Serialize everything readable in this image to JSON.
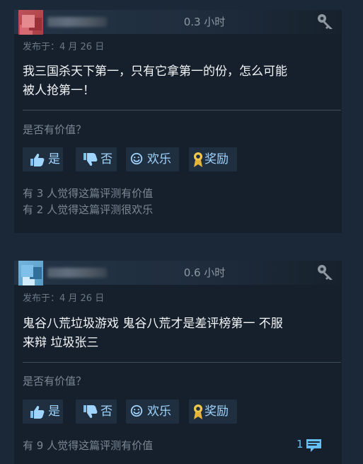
{
  "reviews": [
    {
      "hours": "0.3 小时",
      "posted": "发布于：4 月 26 日",
      "content_lines": [
        "我三国杀天下第一，只有它拿第一的份，怎么可能",
        "被人抢第一！"
      ],
      "helpful_question": "是否有价值？",
      "buttons": {
        "yes": "是",
        "no": "否",
        "funny": "欢乐",
        "award": "奖励"
      },
      "summary_lines": [
        "有 3 人觉得这篇评测有价值",
        "有 2 人觉得这篇评测很欢乐"
      ]
    },
    {
      "hours": "0.6 小时",
      "posted": "发布于：4 月 26 日",
      "content_lines": [
        "鬼谷八荒垃圾游戏 鬼谷八荒才是差评榜第一 不服",
        "来辩 垃圾张三"
      ],
      "helpful_question": "是否有价值？",
      "buttons": {
        "yes": "是",
        "no": "否",
        "funny": "欢乐",
        "award": "奖励"
      },
      "summary_lines": [
        "有 9 人觉得这篇评测有价值"
      ],
      "comment_count": "1"
    }
  ],
  "icons": {
    "key": "key-icon",
    "thumb_up": "thumb-up-icon",
    "thumb_down": "thumb-down-icon",
    "funny": "smile-icon",
    "award": "award-icon",
    "comment": "comment-icon"
  },
  "colors": {
    "background": "#1b2838",
    "panel": "#16202d",
    "header_start": "#243447",
    "text": "#f3f5f7",
    "muted": "#7b8794",
    "button": "#202f3f",
    "button_text": "#9fd4ff",
    "award": "#f2c94c",
    "comment": "#66c0f4"
  }
}
